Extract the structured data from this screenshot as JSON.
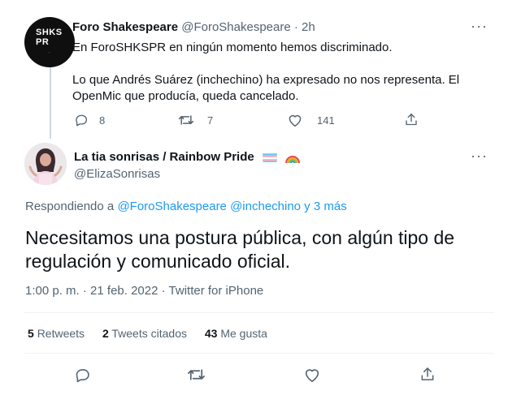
{
  "tweet1": {
    "avatar_text": "SHKSPR",
    "avatar_small": "·",
    "name": "Foro Shakespeare",
    "handle": "@ForoShakespeare",
    "separator": "·",
    "time": "2h",
    "line1": "En ForoSHKSPR en ningún momento hemos discriminado.",
    "line2": "Lo que Andrés Suárez (inchechino) ha expresado no nos representa. El",
    "line3": "OpenMic que producía, queda cancelado.",
    "replies": "8",
    "retweets": "7",
    "likes": "141",
    "more": "···"
  },
  "tweet2": {
    "name": "La tia sonrisas / Rainbow Pride",
    "handle": "@ElizaSonrisas",
    "more": "···",
    "reply_prefix": "Respondiendo a",
    "reply_to": "@ForoShakespeare @inchechino y 3 más",
    "text_line1": "Necesitamos una postura pública, con algún tipo de",
    "text_line2": "regulación y comunicado oficial.",
    "time": "1:00 p. m.",
    "date": "21 feb. 2022",
    "source": "Twitter for iPhone",
    "meta_sep": "·",
    "retweets_count": "5",
    "retweets_label": "Retweets",
    "quotes_count": "2",
    "quotes_label": "Tweets citados",
    "likes_count": "43",
    "likes_label": "Me gusta"
  },
  "colors": {
    "accent": "#1d9bf0",
    "muted": "#536471",
    "divider": "#eff3f4"
  },
  "icons": [
    "reply-icon",
    "retweet-icon",
    "like-icon",
    "share-icon",
    "more-icon",
    "trans-flag-emoji",
    "rainbow-emoji"
  ]
}
